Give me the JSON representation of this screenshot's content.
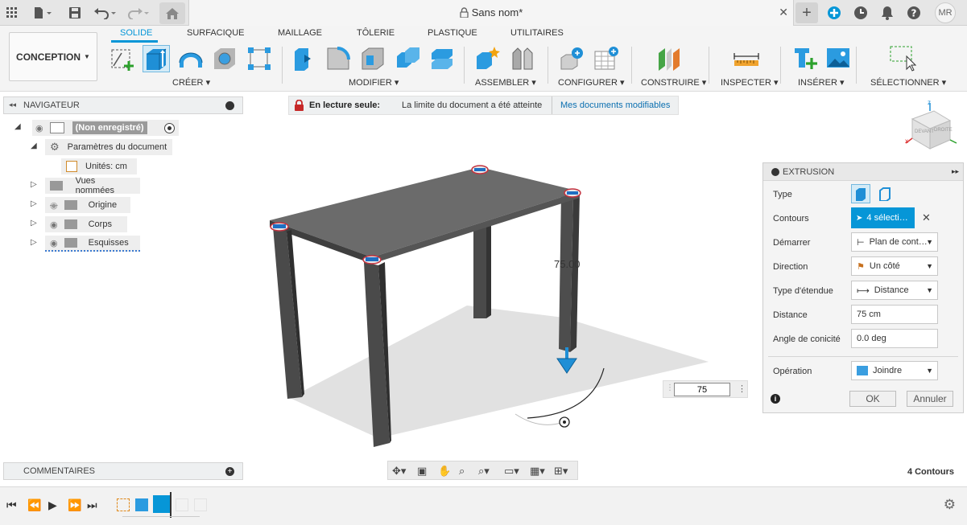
{
  "titlebar": {
    "document_title": "Sans nom*",
    "user_initials": "MR"
  },
  "toolbar": {
    "workspace_label": "CONCEPTION",
    "tabs": [
      "SOLIDE",
      "SURFACIQUE",
      "MAILLAGE",
      "TÔLERIE",
      "PLASTIQUE",
      "UTILITAIRES"
    ],
    "active_tab": "SOLIDE",
    "groups": [
      "CRÉER",
      "MODIFIER",
      "ASSEMBLER",
      "CONFIGURER",
      "CONSTRUIRE",
      "INSPECTER",
      "INSÉRER",
      "SÉLECTIONNER"
    ]
  },
  "navigator": {
    "title": "NAVIGATEUR",
    "root": "(Non enregistré)",
    "doc_settings": "Paramètres du document",
    "units": "Unités: cm",
    "items": [
      "Vues nommées",
      "Origine",
      "Corps",
      "Esquisses"
    ]
  },
  "banner": {
    "readonly_label": "En lecture seule:",
    "message": "La limite du document a été atteinte",
    "link": "Mes documents modifiables"
  },
  "viewport": {
    "dimension_label": "75.00",
    "value_input": "75",
    "viewcube_labels": [
      "DEVANT",
      "DROITE"
    ],
    "status": "4 Contours"
  },
  "extrusion": {
    "title": "EXTRUSION",
    "rows": {
      "type_label": "Type",
      "contours_label": "Contours",
      "contours_value": "4 sélecti…",
      "start_label": "Démarrer",
      "start_value": "Plan de cont…",
      "direction_label": "Direction",
      "direction_value": "Un côté",
      "extent_label": "Type d'étendue",
      "extent_value": "Distance",
      "distance_label": "Distance",
      "distance_value": "75 cm",
      "taper_label": "Angle de conicité",
      "taper_value": "0.0 deg",
      "operation_label": "Opération",
      "operation_value": "Joindre"
    },
    "ok_label": "OK",
    "cancel_label": "Annuler"
  },
  "comments": {
    "title": "COMMENTAIRES"
  },
  "colors": {
    "accent": "#0696d7",
    "table_top": "#6b6b6b",
    "legs": "#4a4a4a"
  }
}
